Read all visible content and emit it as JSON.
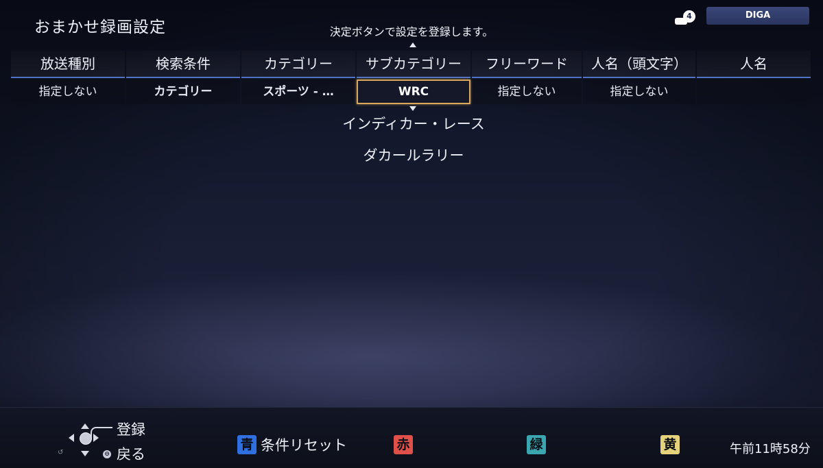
{
  "header": {
    "title": "おまかせ録画設定",
    "instruction": "決定ボタンで設定を登録します。",
    "device_badge_count": "4",
    "device_name": "DIGA"
  },
  "table": {
    "headers": [
      "放送種別",
      "検索条件",
      "カテゴリー",
      "サブカテゴリー",
      "フリーワード",
      "人名（頭文字）",
      "人名"
    ],
    "values": [
      "指定しない",
      "カテゴリー",
      "スポーツ - …",
      "WRC",
      "指定しない",
      "指定しない",
      ""
    ],
    "selected_index": 3
  },
  "options": [
    "インディカー・レース",
    "ダカールラリー"
  ],
  "footer": {
    "dpad_label_register": "登録",
    "dpad_label_back": "戻る",
    "buttons": [
      {
        "key": "青",
        "label": "条件リセット",
        "color": "#2f6fe0"
      },
      {
        "key": "赤",
        "label": "",
        "color": "#e0504a"
      },
      {
        "key": "緑",
        "label": "",
        "color": "#3aa6b0"
      },
      {
        "key": "黄",
        "label": "",
        "color": "#e4d37a"
      }
    ],
    "clock": "午前11時58分"
  }
}
